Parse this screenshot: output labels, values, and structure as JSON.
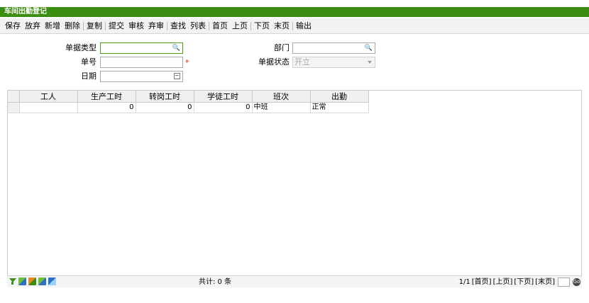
{
  "window": {
    "title": "车间出勤登记"
  },
  "toolbar": {
    "items": [
      "保存",
      "放弃",
      "新增",
      "删除",
      "复制",
      "提交",
      "审核",
      "弃审",
      "查找",
      "列表",
      "首页",
      "上页",
      "下页",
      "末页",
      "输出"
    ]
  },
  "form": {
    "doc_type_label": "单据类型",
    "doc_type_value": "",
    "doc_no_label": "单号",
    "doc_no_value": "",
    "required_mark": "*",
    "date_label": "日期",
    "date_value": "",
    "dept_label": "部门",
    "dept_value": "",
    "status_label": "单据状态",
    "status_value": "开立"
  },
  "grid": {
    "columns": [
      "工人",
      "生产工时",
      "转岗工时",
      "学徒工时",
      "班次",
      "出勤"
    ],
    "rows": [
      {
        "worker": "",
        "prod_hours": "0",
        "transfer_hours": "0",
        "apprentice_hours": "0",
        "shift": "中班",
        "attendance": "正常"
      }
    ]
  },
  "pager": {
    "total": "共计: 0 条",
    "page_info": "1/1",
    "first": "[首页]",
    "prev": "[上页]",
    "next": "[下页]",
    "last": "[末页]",
    "page_input": ""
  }
}
